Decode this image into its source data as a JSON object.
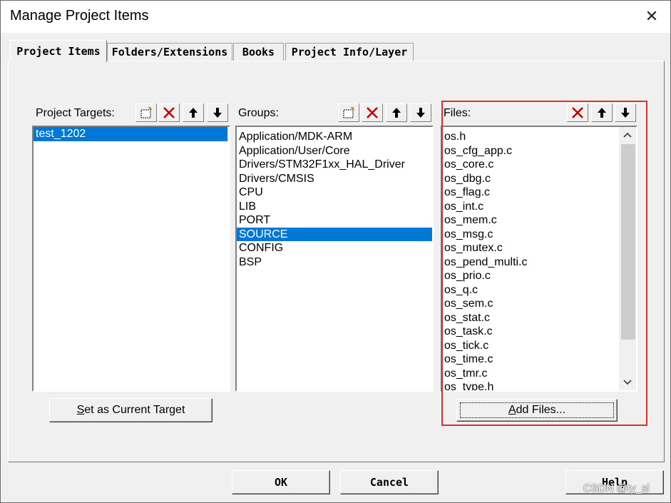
{
  "window": {
    "title": "Manage Project Items",
    "close_glyph": "✕"
  },
  "tabs": [
    {
      "label": "Project Items",
      "active": true
    },
    {
      "label": "Folders/Extensions",
      "active": false
    },
    {
      "label": "Books",
      "active": false
    },
    {
      "label": "Project Info/Layer",
      "active": false
    }
  ],
  "targets": {
    "label": "Project Targets:",
    "items": [
      {
        "text": "test_1202",
        "selected": true
      }
    ],
    "set_current_label": "Set as Current Target",
    "set_current_mnemonic": "S"
  },
  "groups": {
    "label": "Groups:",
    "items": [
      {
        "text": "Application/MDK-ARM",
        "selected": false
      },
      {
        "text": "Application/User/Core",
        "selected": false
      },
      {
        "text": "Drivers/STM32F1xx_HAL_Driver",
        "selected": false
      },
      {
        "text": "Drivers/CMSIS",
        "selected": false
      },
      {
        "text": "CPU",
        "selected": false
      },
      {
        "text": "LIB",
        "selected": false
      },
      {
        "text": "PORT",
        "selected": false
      },
      {
        "text": "SOURCE",
        "selected": true
      },
      {
        "text": "CONFIG",
        "selected": false
      },
      {
        "text": "BSP",
        "selected": false
      }
    ]
  },
  "files": {
    "label": "Files:",
    "items": [
      "os.h",
      "os_cfg_app.c",
      "os_core.c",
      "os_dbg.c",
      "os_flag.c",
      "os_int.c",
      "os_mem.c",
      "os_msg.c",
      "os_mutex.c",
      "os_pend_multi.c",
      "os_prio.c",
      "os_q.c",
      "os_sem.c",
      "os_stat.c",
      "os_task.c",
      "os_tick.c",
      "os_time.c",
      "os_tmr.c",
      "os_type.h"
    ],
    "add_label": "Add Files...",
    "add_mnemonic": "A"
  },
  "footer": {
    "ok_label": "OK",
    "cancel_label": "Cancel",
    "help_label": "Help"
  },
  "watermark": "CSDN @ty_si",
  "colors": {
    "selection": "#0078d7",
    "highlight_box": "#e0302b",
    "delete_icon": "#c00000"
  },
  "icons": [
    "new-item-icon",
    "delete-icon",
    "move-up-icon",
    "move-down-icon",
    "scroll-up-icon",
    "scroll-down-icon",
    "close-icon"
  ]
}
